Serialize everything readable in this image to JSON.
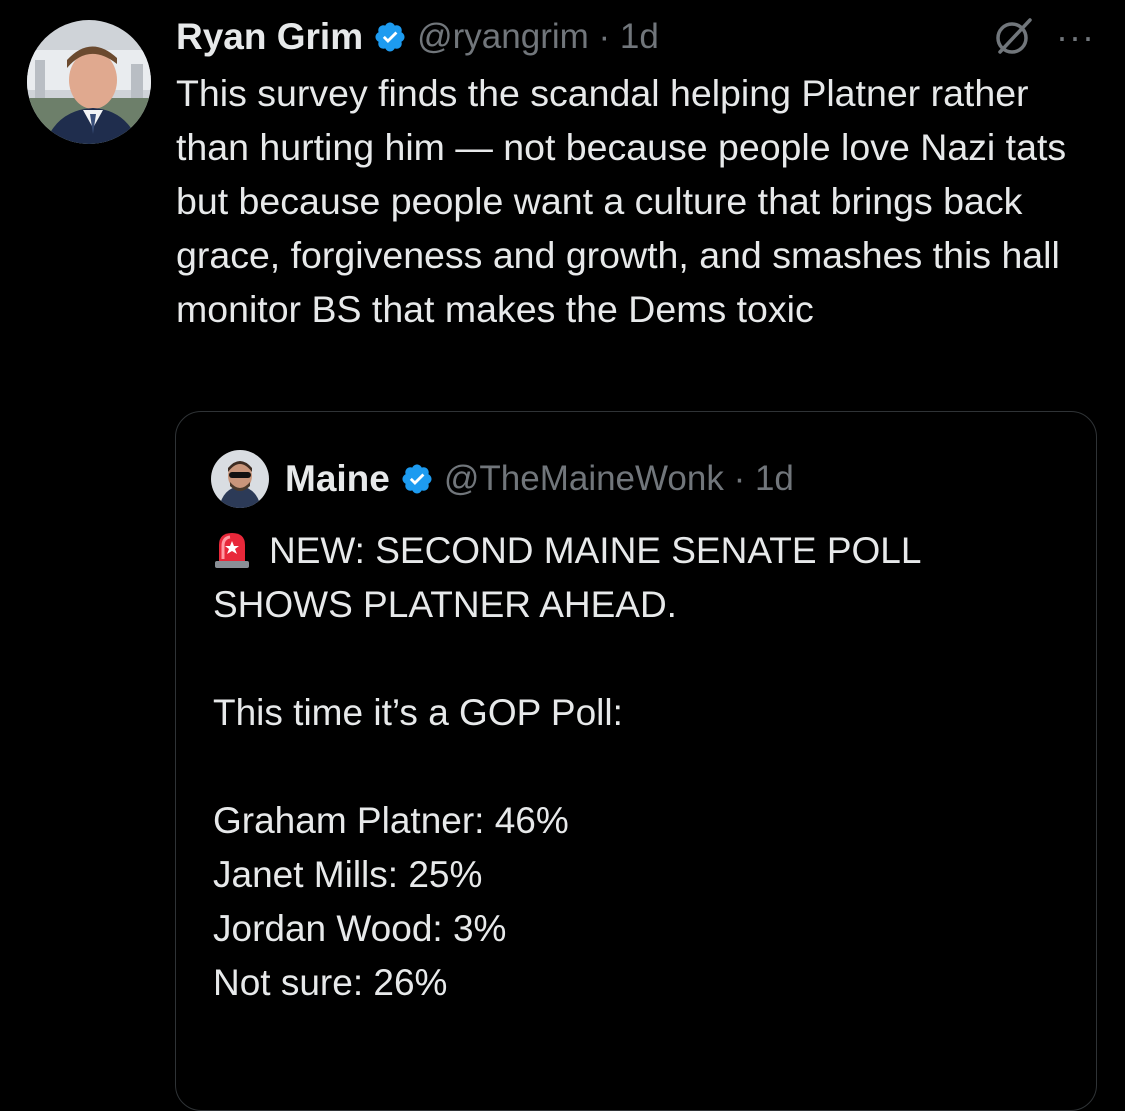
{
  "tweet": {
    "author_name": "Ryan Grim",
    "handle_time": "@ryangrim · 1d",
    "avatar": "ryan-grim-avatar",
    "text": "This survey finds the scandal helping Platner rather than hurting him — not because people love Nazi tats but because people want a culture that brings back grace, forgiveness and growth, and smashes this hall monitor BS that makes the Dems toxic",
    "more_label": "···",
    "icons": [
      "verified-badge-icon",
      "grok-icon",
      "more-icon"
    ],
    "colors": {
      "background": "#000000",
      "text": "#e7e9ea",
      "muted": "#71767b",
      "verified": "#1d9bf0",
      "border": "#2f3336"
    }
  },
  "quote": {
    "author_name": "Maine",
    "handle_time": "@TheMaineWonk · 1d",
    "avatar": "maine-wonk-avatar",
    "lines": [
      "NEW: SECOND MAINE SENATE POLL",
      "SHOWS PLATNER AHEAD.",
      "",
      "This time it’s a GOP Poll:",
      "",
      "Graham Platner: 46%",
      "Janet Mills: 25%",
      "Jordan Wood: 3%",
      "Not sure: 26%"
    ],
    "icons": [
      "siren-emoji-icon",
      "verified-badge-icon"
    ]
  }
}
